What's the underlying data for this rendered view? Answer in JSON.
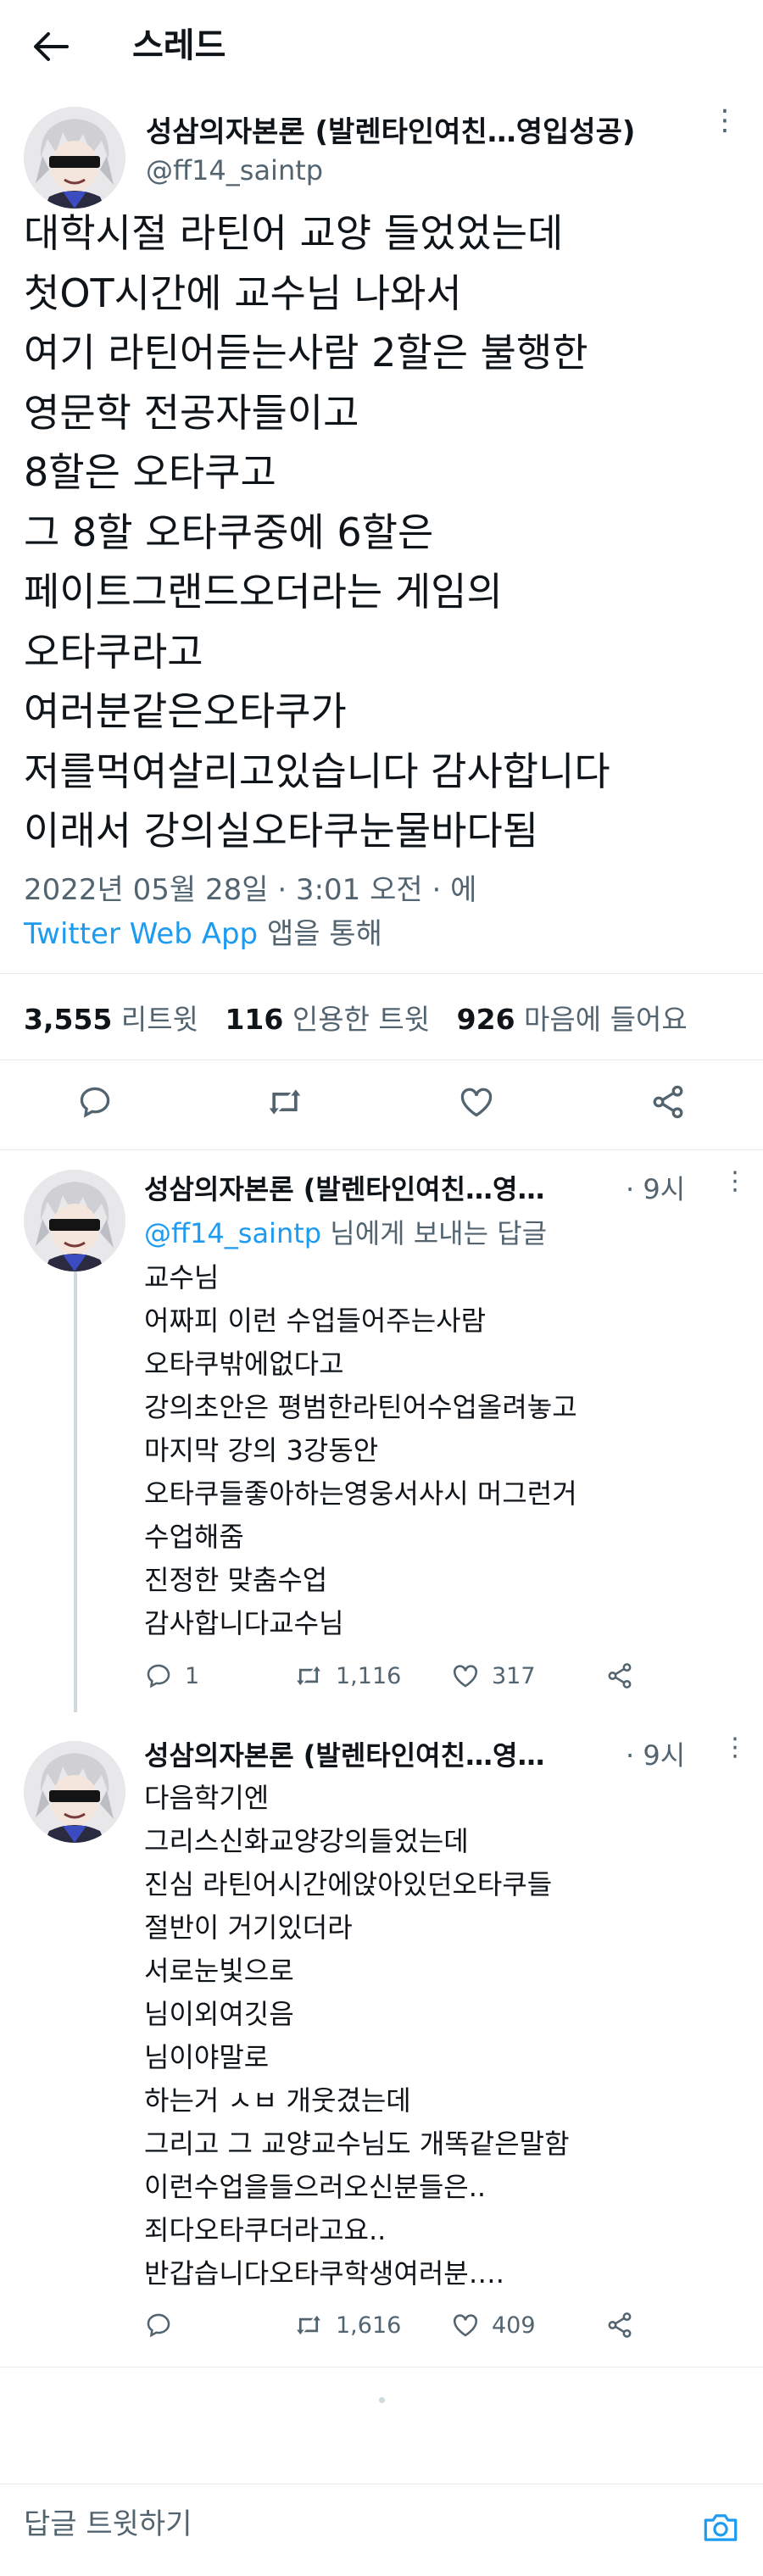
{
  "header": {
    "title": "스레드"
  },
  "tweet": {
    "author_name": "성삼의자본론 (발렌타인여친…영입성공)",
    "author_handle": "@ff14_saintp",
    "body_lines": [
      "대학시절 라틴어 교양 들었었는데",
      "첫OT시간에 교수님 나와서",
      "여기 라틴어듣는사람 2할은 불행한",
      "영문학 전공자들이고",
      "8할은 오타쿠고",
      "그 8할 오타쿠중에 6할은",
      "페이트그랜드오더라는 게임의",
      "오타쿠라고",
      "여러분같은오타쿠가",
      "저를먹여살리고있습니다 감사합니다",
      "이래서 강의실오타쿠눈물바다됨"
    ],
    "timestamp": "2022년 05월 28일 · 3:01 오전 · 에",
    "source_app": "Twitter Web App",
    "source_suffix": "앱을 통해",
    "stats": {
      "retweets": "3,555",
      "retweets_label": "리트윗",
      "quotes": "116",
      "quotes_label": "인용한 트윗",
      "likes": "926",
      "likes_label": "마음에 들어요"
    },
    "icons": [
      "reply-icon",
      "retweet-icon",
      "like-icon",
      "share-icon"
    ]
  },
  "replies": [
    {
      "author_name": "성삼의자본론 (발렌타인여친…영…",
      "time": "· 9시",
      "reply_to_handle": "@ff14_saintp",
      "reply_to_suffix": "님에게 보내는 답글",
      "body_lines": [
        "교수님",
        "어짜피 이런 수업들어주는사람",
        "오타쿠밖에없다고",
        "강의초안은 평범한라틴어수업올려놓고",
        "마지막 강의 3강동안",
        "오타쿠들좋아하는영웅서사시 머그런거",
        "수업해줌",
        "진정한 맞춤수업",
        "감사합니다교수님"
      ],
      "reply_count": "1",
      "retweet_count": "1,116",
      "like_count": "317"
    },
    {
      "author_name": "성삼의자본론 (발렌타인여친…영…",
      "time": "· 9시",
      "body_lines": [
        "다음학기엔",
        "그리스신화교양강의들었는데",
        "진심 라틴어시간에앉아있던오타쿠들",
        "절반이 거기있더라",
        "서로눈빛으로",
        "님이외여깃음",
        "님이야말로",
        "하는거 ㅅㅂ 개웃겼는데",
        "그리고 그 교양교수님도 개똑같은말함",
        "이런수업을들으러오신분들은..",
        "죄다오타쿠더라고요..",
        "반갑습니다오타쿠학생여러분…."
      ],
      "reply_count": "",
      "retweet_count": "1,616",
      "like_count": "409"
    }
  ],
  "composer": {
    "placeholder": "답글 트윗하기"
  },
  "colors": {
    "accent": "#1d9bf0",
    "muted": "#536471",
    "text": "#0f1419",
    "divider": "#e6ecf0"
  }
}
